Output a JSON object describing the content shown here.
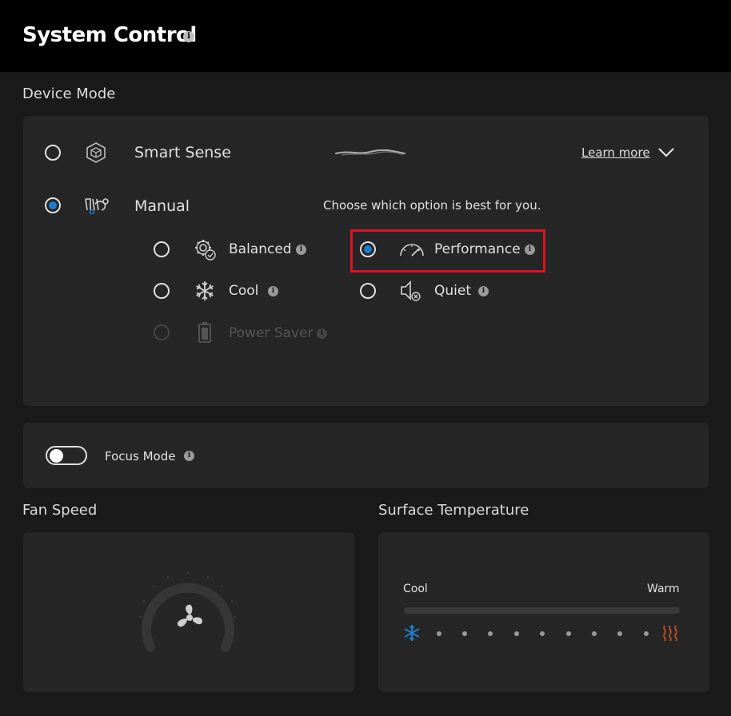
{
  "header": {
    "title": "System Control"
  },
  "device_mode": {
    "section_label": "Device Mode",
    "smart_sense": {
      "label": "Smart Sense",
      "selected": false
    },
    "learn_more": "Learn more",
    "manual": {
      "label": "Manual",
      "selected": true
    },
    "hint": "Choose which option is best for you.",
    "options": {
      "balanced": {
        "label": "Balanced",
        "selected": false
      },
      "performance": {
        "label": "Performance",
        "selected": true
      },
      "cool": {
        "label": "Cool",
        "selected": false
      },
      "quiet": {
        "label": "Quiet",
        "selected": false
      },
      "power_saver": {
        "label": "Power Saver",
        "selected": false,
        "enabled": false
      }
    }
  },
  "focus_mode": {
    "label": "Focus Mode",
    "enabled": false
  },
  "fan_speed": {
    "section_label": "Fan Speed"
  },
  "surface_temperature": {
    "section_label": "Surface Temperature",
    "min_label": "Cool",
    "max_label": "Warm"
  },
  "colors": {
    "accent": "#1a7fd1",
    "highlight": "#e0121c",
    "cool": "#1a7fd1",
    "warm": "#c8501e"
  }
}
